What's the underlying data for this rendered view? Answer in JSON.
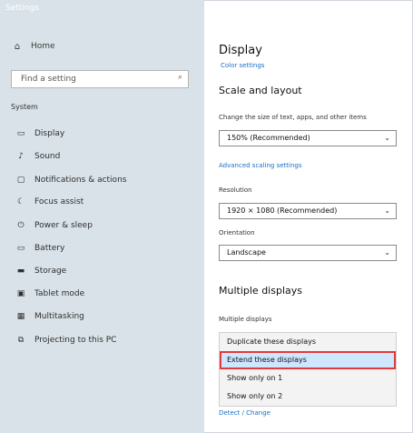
{
  "window": {
    "title": "Settings"
  },
  "nav": {
    "home": {
      "icon": "home-icon",
      "label": "Home"
    },
    "search": {
      "value": "Find a setting",
      "icon": "search-icon"
    },
    "section": "System",
    "items": [
      {
        "icon": "display-icon",
        "label": "Display"
      },
      {
        "icon": "sound-icon",
        "label": "Sound"
      },
      {
        "icon": "notifications-icon",
        "label": "Notifications & actions"
      },
      {
        "icon": "focus-assist-icon",
        "label": "Focus assist"
      },
      {
        "icon": "power-icon",
        "label": "Power & sleep"
      },
      {
        "icon": "battery-icon",
        "label": "Battery"
      },
      {
        "icon": "storage-icon",
        "label": "Storage"
      },
      {
        "icon": "tablet-mode-icon",
        "label": "Tablet mode"
      },
      {
        "icon": "multitasking-icon",
        "label": "Multitasking"
      },
      {
        "icon": "projecting-icon",
        "label": "Projecting to this PC"
      }
    ]
  },
  "content": {
    "title": "Display",
    "title_link": "Color settings",
    "section_scale": "Scale and layout",
    "scale_label": "Change the size of text, apps, and other items",
    "scale_value": "150% (Recommended)",
    "advanced_link": "Advanced scaling settings",
    "resolution_label": "Resolution",
    "resolution_value": "1920 × 1080 (Recommended)",
    "orientation_label": "Orientation",
    "orientation_value": "Landscape",
    "section_multi": "Multiple displays",
    "multi_label": "Multiple displays",
    "multi_options": [
      "Duplicate these displays",
      "Extend these displays",
      "Show only on 1",
      "Show only on 2"
    ],
    "multi_selected_index": 1,
    "bottom_link": "Detect / Change"
  },
  "colors": {
    "nav_bg": "#d9e2e8",
    "link": "#1a6fc9",
    "highlight": "#e33b3b",
    "selected_bg": "#cfe6ff"
  }
}
